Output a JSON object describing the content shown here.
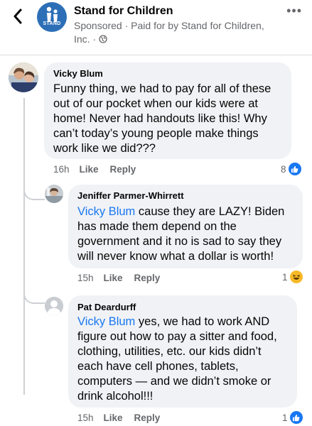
{
  "header": {
    "page_name": "Stand for Children",
    "sponsor_line": "Sponsored · Paid for by Stand for Children, Inc. · ",
    "logo_text": "STAND",
    "more_label": "•••"
  },
  "comments": [
    {
      "author": "Vicky Blum",
      "mention": "",
      "text_lines": [
        "Funny thing, we had to pay for all of these",
        "out of our pocket when our kids were at",
        "home! Never had handouts like this! Why",
        "can’t today’s young people make things",
        "work like we did???"
      ],
      "time": "16h",
      "like": "Like",
      "reply": "Reply",
      "reaction_count": "8",
      "reaction": "like"
    },
    {
      "author": "Jeniffer Parmer-Whirrett",
      "mention": "Vicky Blum",
      "text_first": " cause they are LAZY! Biden",
      "text_lines": [
        "has made them depend on the",
        "government and it  no is sad to say they",
        "will never know what a dollar is worth!"
      ],
      "time": "15h",
      "like": "Like",
      "reply": "Reply",
      "reaction_count": "1",
      "reaction": "haha"
    },
    {
      "author": "Pat Deardurff",
      "mention": "Vicky Blum",
      "text_first": " yes, we had to work AND",
      "text_lines": [
        "figure out how to pay a sitter and food,",
        "clothing, utilities, etc.  our kids didn’t",
        "each have cell phones, tablets,",
        "computers — and we didn’t smoke or",
        "drink alcohol!!!"
      ],
      "time": "15h",
      "like": "Like",
      "reply": "Reply",
      "reaction_count": "1",
      "reaction": "like"
    }
  ],
  "colors": {
    "accent": "#1877f2",
    "bubble": "#f0f2f5",
    "meta": "#65676b",
    "haha": "#f7b928"
  }
}
